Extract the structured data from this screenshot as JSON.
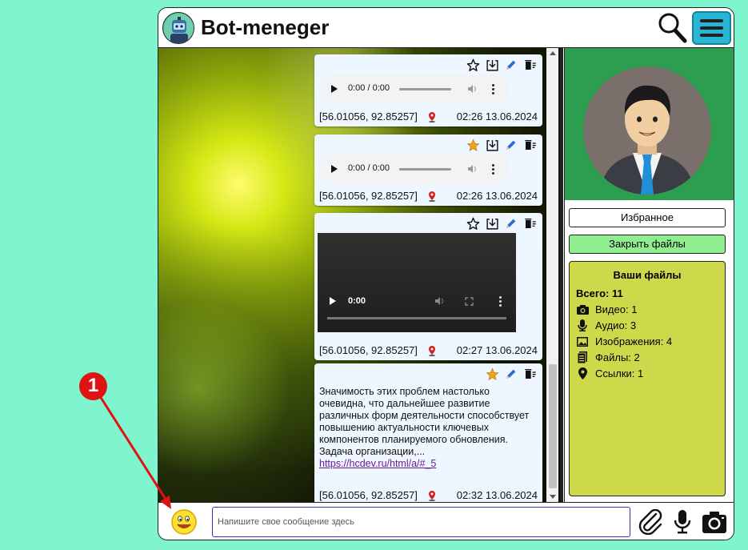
{
  "header": {
    "title": "Bot-meneger"
  },
  "messages": [
    {
      "type": "audio",
      "time_label": "0:00 / 0:00",
      "coords": "[56.01056, 92.85257]",
      "datetime": "02:26 13.06.2024",
      "starred": false
    },
    {
      "type": "audio",
      "time_label": "0:00 / 0:00",
      "coords": "[56.01056, 92.85257]",
      "datetime": "02:26 13.06.2024",
      "starred": true
    },
    {
      "type": "video",
      "time_label": "0:00",
      "coords": "[56.01056, 92.85257]",
      "datetime": "02:27 13.06.2024",
      "starred": false
    },
    {
      "type": "text",
      "text": "Значимость этих проблем настолько очевидна, что дальнейшее развитие различных форм деятельности способствует повышению актуальности ключевых компонентов планируемого обновления. Задача организации,...",
      "link": "https://hcdev.ru/html/a/#_5",
      "coords": "[56.01056, 92.85257]",
      "datetime": "02:32 13.06.2024",
      "starred": true
    }
  ],
  "sidebar": {
    "favorites_label": "Избранное",
    "close_files_label": "Закрыть файлы",
    "files": {
      "title": "Ваши файлы",
      "total": "Всего: 11",
      "rows": [
        {
          "icon": "camera-icon",
          "label": "Видео: 1"
        },
        {
          "icon": "microphone-icon",
          "label": "Аудио: 3"
        },
        {
          "icon": "image-icon",
          "label": "Изображения: 4"
        },
        {
          "icon": "document-icon",
          "label": "Файлы: 2"
        },
        {
          "icon": "location-pin-icon",
          "label": "Ссылки: 1"
        }
      ]
    }
  },
  "composer": {
    "placeholder": "Напишите свое сообщение здесь"
  },
  "annotation": {
    "marker_label": "1"
  },
  "colors": {
    "background": "#7ff5cf",
    "accent": "#29b6d6",
    "profile_bg": "#2d9d4f",
    "files_bg": "#cdd94a",
    "close_btn_bg": "#90ee90",
    "star_active": "#f0a21a"
  }
}
